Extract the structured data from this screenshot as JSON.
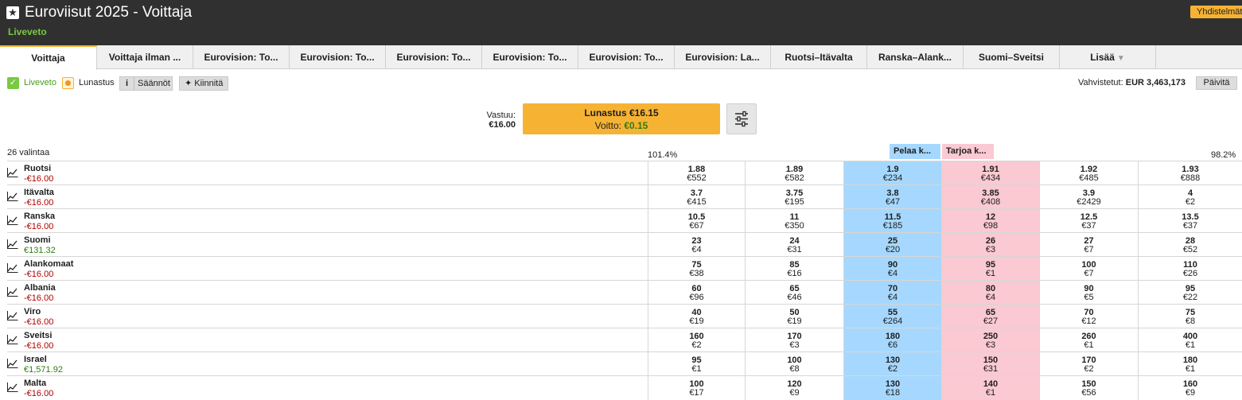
{
  "header": {
    "title": "Euroviisut 2025 - Voittaja",
    "subtitle": "Liveveto",
    "combo_button": "Yhdistelmät"
  },
  "tabs": [
    {
      "label": "Voittaja",
      "active": true
    },
    {
      "label": "Voittaja ilman ..."
    },
    {
      "label": "Eurovision: To..."
    },
    {
      "label": "Eurovision: To..."
    },
    {
      "label": "Eurovision: To..."
    },
    {
      "label": "Eurovision: To..."
    },
    {
      "label": "Eurovision: To..."
    },
    {
      "label": "Eurovision: La..."
    },
    {
      "label": "Ruotsi–Itävalta"
    },
    {
      "label": "Ranska–Alank..."
    },
    {
      "label": "Suomi–Sveitsi"
    },
    {
      "label": "Lisää"
    }
  ],
  "toolbar": {
    "live_label": "Liveveto",
    "cashout_label": "Lunastus",
    "rules_label": "Säännöt",
    "pin_label": "Kiinnitä",
    "confirmed_label": "Vahvistetut:",
    "confirmed_value": "EUR 3,463,173",
    "update_label": "Päivitä"
  },
  "cashout": {
    "liability_label": "Vastuu:",
    "liability_value": "€16.00",
    "button_line1": "Lunastus €16.15",
    "win_label": "Voitto:",
    "win_value": "€0.15"
  },
  "market": {
    "selection_count": "26 valintaa",
    "back_percent": "101.4%",
    "lay_percent": "98.2%",
    "back_header": "Pelaa k...",
    "lay_header": "Tarjoa k..."
  },
  "colors": {
    "back": "#a6d8ff",
    "lay": "#fac9d1",
    "accent": "#f6b333",
    "header_bg": "#303030"
  },
  "runners": [
    {
      "name": "Ruotsi",
      "pl": "-€16.00",
      "pl_sign": "neg",
      "prices": [
        [
          "1.88",
          "€552"
        ],
        [
          "1.89",
          "€582"
        ],
        [
          "1.9",
          "€234"
        ],
        [
          "1.91",
          "€434"
        ],
        [
          "1.92",
          "€485"
        ],
        [
          "1.93",
          "€888"
        ]
      ]
    },
    {
      "name": "Itävalta",
      "pl": "-€16.00",
      "pl_sign": "neg",
      "prices": [
        [
          "3.7",
          "€415"
        ],
        [
          "3.75",
          "€195"
        ],
        [
          "3.8",
          "€47"
        ],
        [
          "3.85",
          "€408"
        ],
        [
          "3.9",
          "€2429"
        ],
        [
          "4",
          "€2"
        ]
      ]
    },
    {
      "name": "Ranska",
      "pl": "-€16.00",
      "pl_sign": "neg",
      "prices": [
        [
          "10.5",
          "€67"
        ],
        [
          "11",
          "€350"
        ],
        [
          "11.5",
          "€185"
        ],
        [
          "12",
          "€98"
        ],
        [
          "12.5",
          "€37"
        ],
        [
          "13.5",
          "€37"
        ]
      ]
    },
    {
      "name": "Suomi",
      "pl": "€131.32",
      "pl_sign": "pos",
      "prices": [
        [
          "23",
          "€4"
        ],
        [
          "24",
          "€31"
        ],
        [
          "25",
          "€20"
        ],
        [
          "26",
          "€3"
        ],
        [
          "27",
          "€7"
        ],
        [
          "28",
          "€52"
        ]
      ]
    },
    {
      "name": "Alankomaat",
      "pl": "-€16.00",
      "pl_sign": "neg",
      "prices": [
        [
          "75",
          "€38"
        ],
        [
          "85",
          "€16"
        ],
        [
          "90",
          "€4"
        ],
        [
          "95",
          "€1"
        ],
        [
          "100",
          "€7"
        ],
        [
          "110",
          "€26"
        ]
      ]
    },
    {
      "name": "Albania",
      "pl": "-€16.00",
      "pl_sign": "neg",
      "prices": [
        [
          "60",
          "€96"
        ],
        [
          "65",
          "€46"
        ],
        [
          "70",
          "€4"
        ],
        [
          "80",
          "€4"
        ],
        [
          "90",
          "€5"
        ],
        [
          "95",
          "€22"
        ]
      ]
    },
    {
      "name": "Viro",
      "pl": "-€16.00",
      "pl_sign": "neg",
      "prices": [
        [
          "40",
          "€19"
        ],
        [
          "50",
          "€19"
        ],
        [
          "55",
          "€264"
        ],
        [
          "65",
          "€27"
        ],
        [
          "70",
          "€12"
        ],
        [
          "75",
          "€8"
        ]
      ]
    },
    {
      "name": "Sveitsi",
      "pl": "-€16.00",
      "pl_sign": "neg",
      "prices": [
        [
          "160",
          "€2"
        ],
        [
          "170",
          "€3"
        ],
        [
          "180",
          "€6"
        ],
        [
          "250",
          "€3"
        ],
        [
          "260",
          "€1"
        ],
        [
          "400",
          "€1"
        ]
      ]
    },
    {
      "name": "Israel",
      "pl": "€1,571.92",
      "pl_sign": "pos",
      "prices": [
        [
          "95",
          "€1"
        ],
        [
          "100",
          "€8"
        ],
        [
          "130",
          "€2"
        ],
        [
          "150",
          "€31"
        ],
        [
          "170",
          "€2"
        ],
        [
          "180",
          "€1"
        ]
      ]
    },
    {
      "name": "Malta",
      "pl": "-€16.00",
      "pl_sign": "neg",
      "prices": [
        [
          "100",
          "€17"
        ],
        [
          "120",
          "€9"
        ],
        [
          "130",
          "€18"
        ],
        [
          "140",
          "€1"
        ],
        [
          "150",
          "€56"
        ],
        [
          "160",
          "€9"
        ]
      ]
    }
  ]
}
